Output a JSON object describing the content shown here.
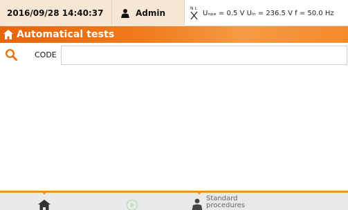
{
  "status": {
    "datetime": "2016/09/28 14:40:37",
    "user": "Admin",
    "measurements": "Uₙₚₑ = 0.5 V Uₗₙ = 236.5 V f = 50.0 Hz",
    "probe_label": "N L"
  },
  "title": {
    "text": "Automatical tests"
  },
  "search": {
    "label": "CODE",
    "value": "",
    "placeholder": ""
  },
  "toolbar": {
    "standard_label": "Standard procedures"
  },
  "colors": {
    "accent": "#ef7a1c",
    "status_bg": "#f6e7d4",
    "toolbar_bg": "#e9e9e9"
  }
}
